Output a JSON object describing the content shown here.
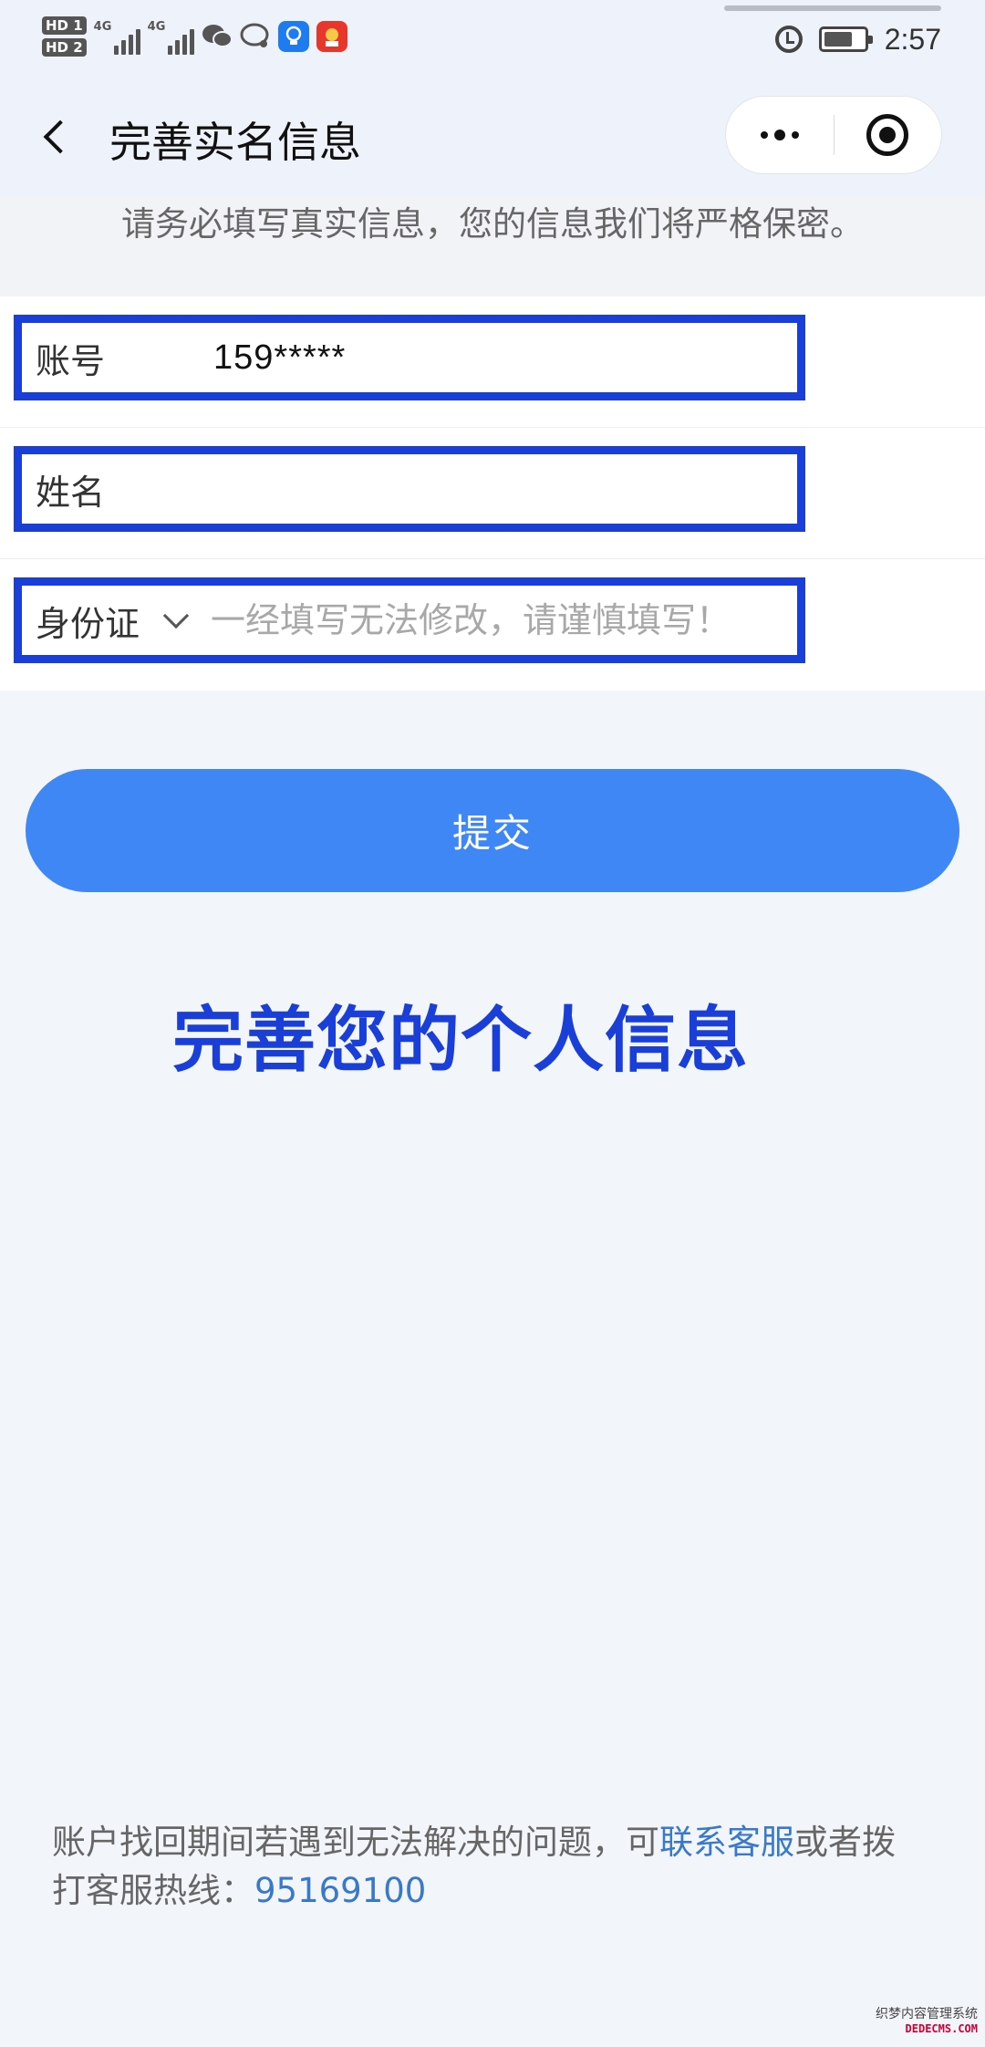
{
  "status_bar": {
    "hd1": "HD 1",
    "hd2": "HD 2",
    "signal1_label": "4G",
    "signal2_label": "4G",
    "time": "2:57",
    "icons": [
      "wechat-icon",
      "message-icon",
      "lightbulb-app-icon",
      "red-app-icon",
      "alarm-icon",
      "battery-icon"
    ]
  },
  "nav": {
    "back_icon": "chevron-left-icon",
    "title": "完善实名信息",
    "more_icon": "more-dots-icon",
    "close_icon": "target-close-icon"
  },
  "notice": "请务必填写真实信息，您的信息我们将严格保密。",
  "form": {
    "account": {
      "label": "账号",
      "value": "159*****"
    },
    "name": {
      "label": "姓名",
      "value": "",
      "placeholder": ""
    },
    "id": {
      "type_label": "身份证",
      "caret_icon": "chevron-down-icon",
      "value": "",
      "placeholder": "一经填写无法修改，请谨慎填写！"
    }
  },
  "submit_label": "提交",
  "headline": "完善您的个人信息",
  "footer": {
    "text_before": "账户找回期间若遇到无法解决的问题，可",
    "link": "联系客服",
    "text_after": "或者拨打客服热线：",
    "phone": "95169100"
  },
  "watermark": {
    "cn": "织梦内容管理系统",
    "en": "DEDECMS.COM"
  },
  "colors": {
    "accent_blue": "#3f87f5",
    "highlight_blue": "#1a3fd8",
    "link_blue": "#3a78c9",
    "page_bg": "#f2f5f9"
  }
}
